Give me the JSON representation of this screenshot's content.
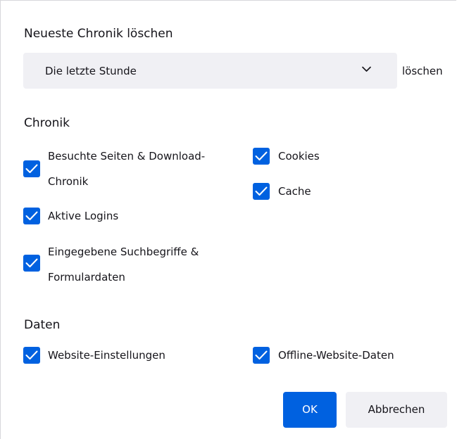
{
  "dialog": {
    "title": "Neueste Chronik löschen",
    "range": {
      "selected": "Die letzte Stunde",
      "suffix": "löschen"
    },
    "history_section": {
      "heading": "Chronik",
      "items": [
        {
          "label_line1": "Besuchte Seiten & Download-",
          "label_line2": "Chronik",
          "checked": true
        },
        {
          "label": "Cookies",
          "checked": true
        },
        {
          "label": "Cache",
          "checked": true
        },
        {
          "label": "Aktive Logins",
          "checked": true
        },
        {
          "label_line1": "Eingegebene Suchbegriffe &",
          "label_line2": "Formulardaten",
          "checked": true
        }
      ]
    },
    "data_section": {
      "heading": "Daten",
      "items": [
        {
          "label": "Website-Einstellungen",
          "checked": true
        },
        {
          "label": "Offline-Website-Daten",
          "checked": true
        }
      ]
    },
    "buttons": {
      "ok": "OK",
      "cancel": "Abbrechen"
    }
  },
  "colors": {
    "accent": "#0061e0",
    "select_bg": "#f0f0f4",
    "text": "#15141a"
  }
}
